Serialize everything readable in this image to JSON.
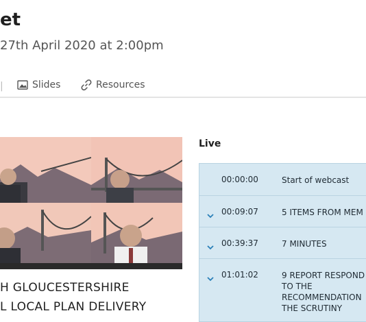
{
  "header": {
    "title": "et",
    "subtitle": "27th April 2020 at 2:00pm"
  },
  "tabs": [
    {
      "label": "Slides",
      "icon": "slides-icon"
    },
    {
      "label": "Resources",
      "icon": "link-icon"
    }
  ],
  "live": {
    "label": "Live"
  },
  "chapters": [
    {
      "time": "00:00:00",
      "title": "Start of webcast",
      "expandable": false
    },
    {
      "time": "00:09:07",
      "title": "5 ITEMS FROM MEM",
      "expandable": true
    },
    {
      "time": "00:39:37",
      "title": "7 MINUTES",
      "expandable": true
    },
    {
      "time": "01:01:02",
      "title": "9 REPORT RESPOND\nTO THE\nRECOMMENDATION\nTHE SCRUTINY",
      "expandable": true
    }
  ],
  "session": {
    "title_line1": "H GLOUCESTERSHIRE",
    "title_line2": "L LOCAL PLAN DELIVERY"
  },
  "colors": {
    "chapter_bg": "#d6e8f2",
    "chevron": "#2a7fb8",
    "bridge_sky": "#f2c4b6"
  }
}
